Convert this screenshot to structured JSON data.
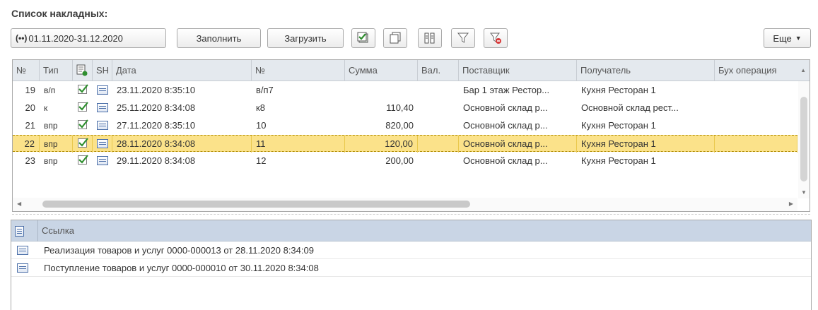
{
  "title": "Список накладных:",
  "toolbar": {
    "period_icon": "(••)",
    "period": "01.11.2020-31.12.2020",
    "fill_label": "Заполнить",
    "load_label": "Загрузить",
    "icons": [
      "check-all-icon",
      "copy-icon",
      "columns-icon",
      "filter-icon",
      "clear-filter-icon"
    ],
    "more_label": "Еще"
  },
  "grid": {
    "columns": [
      "№",
      "Тип",
      "",
      "SH",
      "Дата",
      "№",
      "Сумма",
      "Вал.",
      "Поставщик",
      "Получатель",
      "Бух операция"
    ],
    "rows": [
      {
        "n": "19",
        "type": "в/п",
        "date": "23.11.2020 8:35:10",
        "num": "в/п7",
        "sum": "",
        "val": "",
        "supplier": "Бар 1 этаж Рестор...",
        "receiver": "Кухня Ресторан 1",
        "op": ""
      },
      {
        "n": "20",
        "type": "к",
        "date": "25.11.2020 8:34:08",
        "num": "к8",
        "sum": "110,40",
        "val": "",
        "supplier": "Основной склад р...",
        "receiver": "Основной склад рест...",
        "op": ""
      },
      {
        "n": "21",
        "type": "впр",
        "date": "27.11.2020 8:35:10",
        "num": "10",
        "sum": "820,00",
        "val": "",
        "supplier": "Основной склад р...",
        "receiver": "Кухня Ресторан 1",
        "op": ""
      },
      {
        "n": "22",
        "type": "впр",
        "date": "28.11.2020 8:34:08",
        "num": "11",
        "sum": "120,00",
        "val": "",
        "supplier": "Основной склад р...",
        "receiver": "Кухня Ресторан 1",
        "op": "",
        "selected": true
      },
      {
        "n": "23",
        "type": "впр",
        "date": "29.11.2020 8:34:08",
        "num": "12",
        "sum": "200,00",
        "val": "",
        "supplier": "Основной склад р...",
        "receiver": "Кухня Ресторан 1",
        "op": ""
      }
    ]
  },
  "links": {
    "header": "Ссылка",
    "rows": [
      "Реализация товаров и услуг 0000-000013 от 28.11.2020 8:34:09",
      "Поступление товаров и услуг 0000-000010 от 30.11.2020 8:34:08"
    ]
  },
  "colors": {
    "selected_row": "#fbe28a",
    "header_bg": "#e4e9ee",
    "link_header_bg": "#c9d5e5",
    "check_green": "#2f8f2f"
  }
}
